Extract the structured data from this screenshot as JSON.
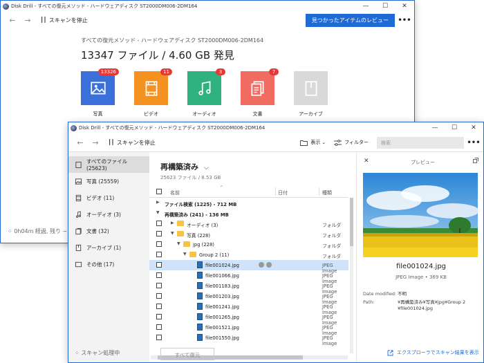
{
  "back_window": {
    "title": "Disk Drill - すべての復元メソッド - ハードウェアディスク ST2000DM006-2DM164",
    "toolbar": {
      "pause_label": "スキャンを停止",
      "review_button": "見つかったアイテムのレビュー",
      "more": "•••"
    },
    "subtitle": "すべての復元メソッド - ハードウェアディスク ST2000DM006-2DM164",
    "headline": "13347 ファイル / 4.60 GB 発見",
    "categories": [
      {
        "label": "写真",
        "count": "13326",
        "color": "#3b6fd9"
      },
      {
        "label": "ビデオ",
        "count": "11",
        "color": "#f39221"
      },
      {
        "label": "オーディオ",
        "count": "3",
        "color": "#2fb27d"
      },
      {
        "label": "文書",
        "count": "7",
        "color": "#f26b63"
      },
      {
        "label": "アーカイブ",
        "count": "",
        "color": "#d9d9d9"
      }
    ],
    "status": "0h04m 経過, 残り ~"
  },
  "front_window": {
    "title": "Disk Drill - すべての復元メソッド - ハードウェアディスク ST2000DM006-2DM164",
    "toolbar": {
      "pause_label": "スキャンを停止",
      "view_label": "表示",
      "filter_label": "フィルター",
      "search_placeholder": "検索",
      "more": "•••"
    },
    "sidebar": {
      "items": [
        {
          "label": "すべてのファイル (25623)",
          "icon": "file-icon",
          "active": true
        },
        {
          "label": "写真 (25559)",
          "icon": "photo-icon"
        },
        {
          "label": "ビデオ (11)",
          "icon": "video-icon"
        },
        {
          "label": "オーディオ (3)",
          "icon": "music-icon"
        },
        {
          "label": "文書 (32)",
          "icon": "document-icon"
        },
        {
          "label": "アーカイブ (1)",
          "icon": "archive-icon"
        },
        {
          "label": "その他 (17)",
          "icon": "other-icon"
        }
      ],
      "status": "スキャン処理中"
    },
    "main": {
      "title": "再構築済み",
      "subtitle": "25623 ファイル / 8.53 GB",
      "columns": {
        "name": "名前",
        "date": "日付",
        "type": "種類"
      },
      "rows": [
        {
          "kind": "group",
          "name": "ファイル検索 (1225) - 712 MB",
          "expanded": false
        },
        {
          "kind": "group",
          "name": "再構築済み (241) - 136 MB",
          "expanded": true
        },
        {
          "kind": "folder",
          "indent": 1,
          "name": "オーディオ (3)",
          "type": "フォルダ",
          "expanded": false
        },
        {
          "kind": "folder",
          "indent": 1,
          "name": "写真 (228)",
          "type": "フォルダ",
          "expanded": true
        },
        {
          "kind": "folder",
          "indent": 2,
          "name": "jpg (228)",
          "type": "フォルダ",
          "expanded": true
        },
        {
          "kind": "folder",
          "indent": 3,
          "name": "Group 2 (11)",
          "type": "フォルダ",
          "expanded": true
        },
        {
          "kind": "file",
          "indent": 4,
          "name": "file001024.jpg",
          "type": "JPEG Image",
          "selected": true
        },
        {
          "kind": "file",
          "indent": 4,
          "name": "file001066.jpg",
          "type": "JPEG Image"
        },
        {
          "kind": "file",
          "indent": 4,
          "name": "file001183.jpg",
          "type": "JPEG Image"
        },
        {
          "kind": "file",
          "indent": 4,
          "name": "file001203.jpg",
          "type": "JPEG Image"
        },
        {
          "kind": "file",
          "indent": 4,
          "name": "file001241.jpg",
          "type": "JPEG Image"
        },
        {
          "kind": "file",
          "indent": 4,
          "name": "file001265.jpg",
          "type": "JPEG Image"
        },
        {
          "kind": "file",
          "indent": 4,
          "name": "file001521.jpg",
          "type": "JPEG Image"
        },
        {
          "kind": "file",
          "indent": 4,
          "name": "file001550.jpg",
          "type": "JPEG Image"
        }
      ],
      "recover_all": "すべて復元"
    },
    "preview": {
      "title": "プレビュー",
      "file_name": "file001024.jpg",
      "meta": "JPEG Image • 369 KB",
      "date_label": "Date modified:",
      "date_value": "不明",
      "path_label": "Path:",
      "path_value": "¥再構築済み¥写真¥jpg¥Group 2 ¥file001024.jpg",
      "explorer_link": "エクスプローラでスキャン結果を表示"
    }
  },
  "colors": {
    "accent": "#1e6ad6",
    "badge": "#e53935",
    "selected_row": "#cfe4fb"
  }
}
